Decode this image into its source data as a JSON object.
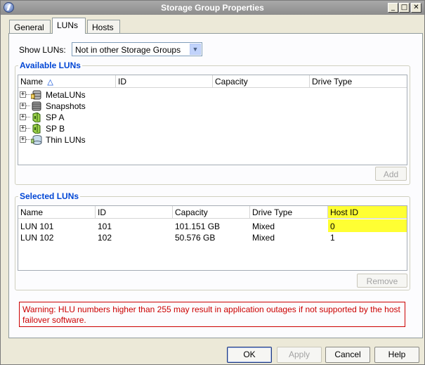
{
  "window": {
    "title": "Storage Group Properties",
    "controls": {
      "minimize": "_",
      "maximize": "□",
      "close": "✕"
    }
  },
  "tabs": [
    {
      "label": "General"
    },
    {
      "label": "LUNs",
      "active": true
    },
    {
      "label": "Hosts"
    }
  ],
  "filter": {
    "label": "Show LUNs:",
    "selected": "Not in other Storage Groups"
  },
  "available_luns": {
    "title": "Available LUNs",
    "columns": [
      "Name",
      "ID",
      "Capacity",
      "Drive Type"
    ],
    "sort_icon": "sort-ascending-icon",
    "tree": [
      {
        "label": "MetaLUNs",
        "icon": "metalun-icon"
      },
      {
        "label": "Snapshots",
        "icon": "snapshot-icon"
      },
      {
        "label": "SP A",
        "icon": "storage-processor-icon"
      },
      {
        "label": "SP B",
        "icon": "storage-processor-icon"
      },
      {
        "label": "Thin LUNs",
        "icon": "thin-lun-icon"
      }
    ],
    "add_label": "Add"
  },
  "selected_luns": {
    "title": "Selected LUNs",
    "columns": [
      "Name",
      "ID",
      "Capacity",
      "Drive Type",
      "Host ID"
    ],
    "rows": [
      {
        "name": "LUN 101",
        "id": "101",
        "capacity": "101.151 GB",
        "drive_type": "Mixed",
        "host_id": "0"
      },
      {
        "name": "LUN 102",
        "id": "102",
        "capacity": "50.576 GB",
        "drive_type": "Mixed",
        "host_id": "1"
      }
    ],
    "remove_label": "Remove"
  },
  "warning": "Warning: HLU numbers higher than 255 may result in application outages if not supported by the host failover software.",
  "buttons": {
    "ok": "OK",
    "apply": "Apply",
    "cancel": "Cancel",
    "help": "Help"
  },
  "colors": {
    "highlight": "#ffff33",
    "group_title": "#0046d5",
    "warning": "#cc0000"
  }
}
